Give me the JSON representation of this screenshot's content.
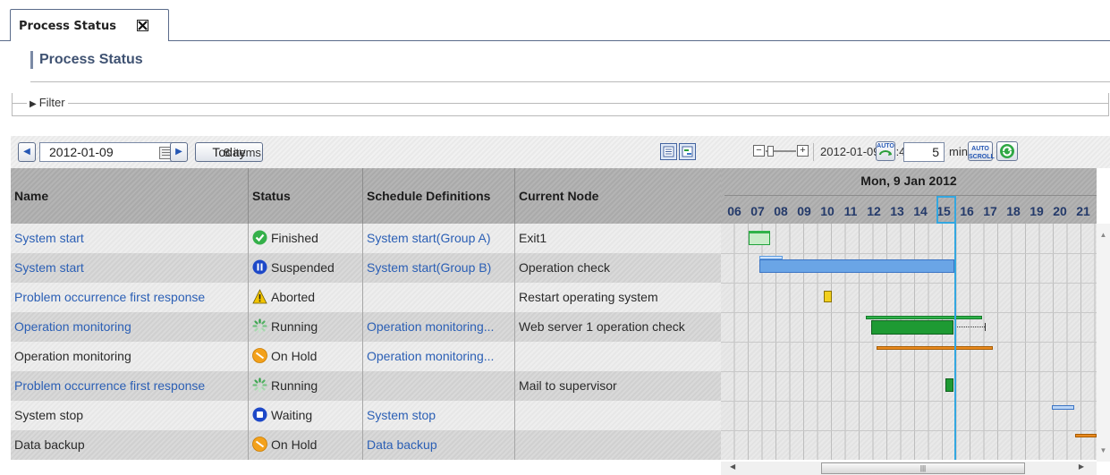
{
  "tab": {
    "label": "Process Status"
  },
  "page_title": "Process Status",
  "filter": {
    "label": "Filter"
  },
  "toolbar": {
    "date": "2012-01-09",
    "today_label": "Today",
    "items_count": "8 items",
    "current_time": "2012-01-09 15:45",
    "auto_label": "AUTO",
    "interval_value": "5",
    "interval_unit": "min",
    "auto_scroll_label_1": "AUTO",
    "auto_scroll_label_2": "SCROLL"
  },
  "columns": {
    "name": "Name",
    "status": "Status",
    "schedule": "Schedule Definitions",
    "node": "Current Node"
  },
  "gantt": {
    "date_label": "Mon, 9 Jan 2012",
    "hours": [
      "06",
      "07",
      "08",
      "09",
      "10",
      "11",
      "12",
      "13",
      "14",
      "15",
      "16",
      "17",
      "18",
      "19",
      "20",
      "21"
    ],
    "current_hour": "15"
  },
  "rows": [
    {
      "name": "System start",
      "name_link": true,
      "status": "Finished",
      "status_icon": "check-icon",
      "schedule": "System start(Group A)",
      "node": "Exit1"
    },
    {
      "name": "System start",
      "name_link": true,
      "status": "Suspended",
      "status_icon": "pause-icon",
      "schedule": "System start(Group B)",
      "node": "Operation check"
    },
    {
      "name": "Problem occurrence first response",
      "name_link": true,
      "status": "Aborted",
      "status_icon": "warning-icon",
      "schedule": "",
      "node": "Restart operating system"
    },
    {
      "name": "Operation monitoring",
      "name_link": true,
      "status": "Running",
      "status_icon": "spinner-icon",
      "schedule": "Operation monitoring...",
      "node": "Web server 1 operation check"
    },
    {
      "name": "Operation monitoring",
      "name_link": false,
      "status": "On Hold",
      "status_icon": "hold-icon",
      "schedule": "Operation monitoring...",
      "node": ""
    },
    {
      "name": "Problem occurrence first response",
      "name_link": true,
      "status": "Running",
      "status_icon": "spinner-icon",
      "schedule": "",
      "node": "Mail to supervisor"
    },
    {
      "name": "System stop",
      "name_link": false,
      "status": "Waiting",
      "status_icon": "stop-icon",
      "schedule": "System stop",
      "node": ""
    },
    {
      "name": "Data backup",
      "name_link": false,
      "status": "On Hold",
      "status_icon": "hold-icon",
      "schedule": "Data backup",
      "node": ""
    }
  ],
  "colors": {
    "link": "#2b5fb5",
    "now_line": "#33a7e0",
    "bar_green": "#1fa33a",
    "bar_blue": "#5c9be0",
    "bar_yellow": "#f2d01e",
    "bar_orange": "#e98a1f"
  }
}
